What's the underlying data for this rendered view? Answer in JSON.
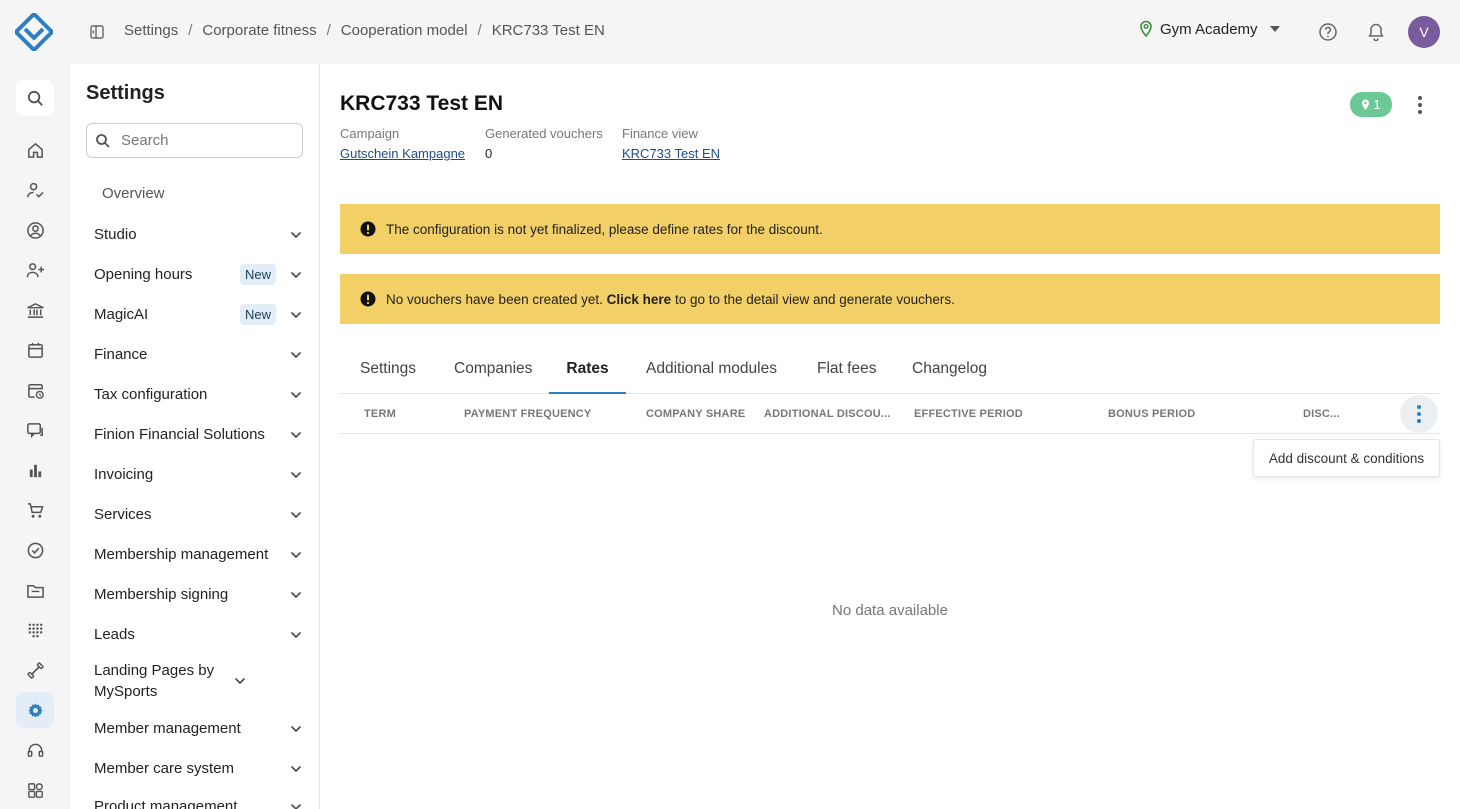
{
  "breadcrumb": [
    "Settings",
    "Corporate fitness",
    "Cooperation model",
    "KRC733 Test EN"
  ],
  "studio": "Gym Academy",
  "user_initial": "V",
  "rail_icons": [
    "search-icon",
    "home-icon",
    "user-check-icon",
    "user-circle-icon",
    "user-add-icon",
    "bank-icon",
    "calendar-icon",
    "calendar-clock-icon",
    "chat-icon",
    "bar-chart-icon",
    "cart-icon",
    "check-circle-icon",
    "folder-icon",
    "dots-grid-icon",
    "dumbbell-icon",
    "gear-icon",
    "headset-icon",
    "apps-icon"
  ],
  "sidebar": {
    "title": "Settings",
    "search_placeholder": "Search",
    "overview": "Overview",
    "items": [
      {
        "label": "Studio",
        "badge": ""
      },
      {
        "label": "Opening hours",
        "badge": "New"
      },
      {
        "label": "MagicAI",
        "badge": "New"
      },
      {
        "label": "Finance",
        "badge": ""
      },
      {
        "label": "Tax configuration",
        "badge": ""
      },
      {
        "label": "Finion Financial Solutions",
        "badge": ""
      },
      {
        "label": "Invoicing",
        "badge": ""
      },
      {
        "label": "Services",
        "badge": ""
      },
      {
        "label": "Membership management",
        "badge": ""
      },
      {
        "label": "Membership signing",
        "badge": ""
      },
      {
        "label": "Leads",
        "badge": ""
      },
      {
        "label": "Landing Pages by MySports",
        "badge": ""
      },
      {
        "label": "Member management",
        "badge": ""
      },
      {
        "label": "Member care system",
        "badge": ""
      },
      {
        "label": "Product management",
        "badge": ""
      }
    ]
  },
  "page": {
    "title": "KRC733 Test EN",
    "pin_count": "1",
    "meta": [
      {
        "key": "Campaign",
        "value": "Gutschein Kampagne",
        "is_link": true
      },
      {
        "key": "Generated vouchers",
        "value": "0",
        "is_link": false
      },
      {
        "key": "Finance view",
        "value": "KRC733 Test EN",
        "is_link": true
      }
    ]
  },
  "alerts": [
    {
      "text_before": "The configuration is not yet finalized, please define rates for the discount.",
      "bold": "",
      "text_after": ""
    },
    {
      "text_before": "No vouchers have been created yet. ",
      "bold": "Click here",
      "text_after": " to go to the detail view and generate vouchers."
    }
  ],
  "tabs": [
    {
      "label": "Settings",
      "active": false
    },
    {
      "label": "Companies",
      "active": false
    },
    {
      "label": "Rates",
      "active": true
    },
    {
      "label": "Additional modules",
      "active": false
    },
    {
      "label": "Flat fees",
      "active": false
    },
    {
      "label": "Changelog",
      "active": false
    }
  ],
  "table": {
    "columns": [
      "TERM",
      "PAYMENT FREQUENCY",
      "COMPANY SHARE",
      "ADDITIONAL DISCOU...",
      "EFFECTIVE PERIOD",
      "BONUS PERIOD",
      "DISC..."
    ],
    "empty_text": "No data available"
  },
  "context_menu": {
    "items": [
      "Add discount & conditions"
    ]
  },
  "colors": {
    "accent": "#2f7fc1",
    "alert_bg": "#f2cf67",
    "pin_badge": "#6cc995",
    "avatar": "#7a5c9e",
    "link": "#1b4f8a"
  }
}
